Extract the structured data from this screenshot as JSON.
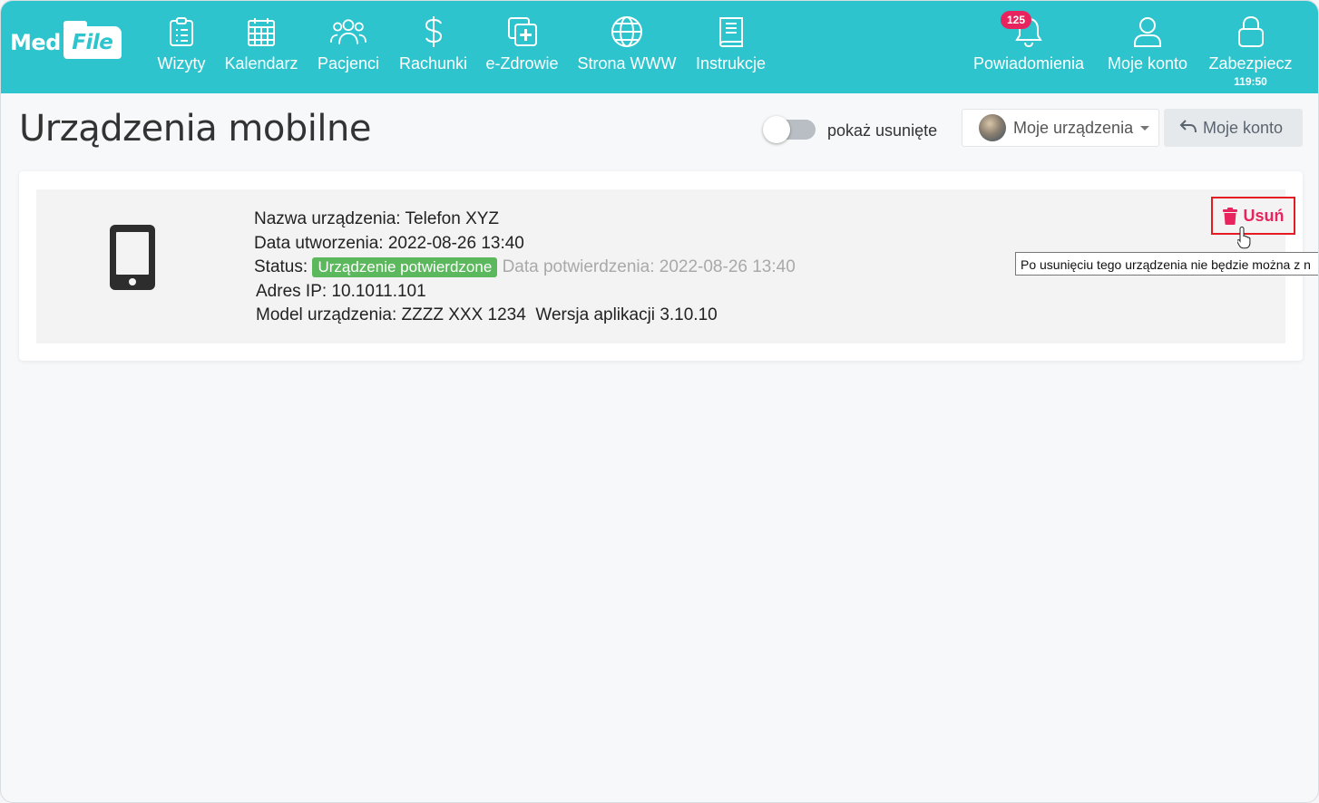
{
  "logo": {
    "part1": "Med",
    "part2": "File"
  },
  "nav": {
    "items": [
      {
        "label": "Wizyty",
        "icon": "clipboard-list-icon"
      },
      {
        "label": "Kalendarz",
        "icon": "calendar-icon"
      },
      {
        "label": "Pacjenci",
        "icon": "users-icon"
      },
      {
        "label": "Rachunki",
        "icon": "dollar-icon"
      },
      {
        "label": "e-Zdrowie",
        "icon": "medical-plus-icon"
      },
      {
        "label": "Strona WWW",
        "icon": "globe-icon"
      },
      {
        "label": "Instrukcje",
        "icon": "book-icon"
      }
    ],
    "notifications": {
      "label": "Powiadomienia",
      "badge": "125",
      "icon": "bell-icon"
    },
    "account": {
      "label": "Moje konto",
      "icon": "user-icon"
    },
    "lock": {
      "label": "Zabezpiecz",
      "timer": "119:50",
      "icon": "lock-icon"
    }
  },
  "header": {
    "title": "Urządzenia mobilne",
    "toggle_label": "pokaż usunięte",
    "toggle_on": false,
    "devices_select": "Moje urządzenia",
    "back_button": "Moje konto"
  },
  "device": {
    "name_label": "Nazwa urządzenia:",
    "name_value": "Telefon XYZ",
    "created_label": "Data utworzenia:",
    "created_value": "2022-08-26 13:40",
    "status_label": "Status:",
    "status_value": "Urządzenie potwierdzone",
    "confirmed_text": "Data potwierdzenia: 2022-08-26 13:40",
    "ip_label": "Adres IP:",
    "ip_value": "10.1011.101",
    "model_label": "Model urządzenia:",
    "model_value": "ZZZZ XXX 1234",
    "version_label": "Wersja aplikacji",
    "version_value": "3.10.10",
    "delete_button": "Usuń",
    "tooltip": "Po usunięciu tego urządzenia nie będzie można z n"
  },
  "colors": {
    "topbar": "#2ec4cd",
    "badge": "#e8245e",
    "status_green": "#5cb85c",
    "delete_pink": "#e8245e",
    "highlight_red": "#e31b23"
  }
}
